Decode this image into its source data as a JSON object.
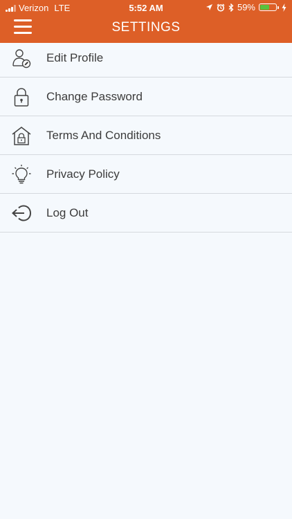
{
  "status_bar": {
    "carrier": "Verizon",
    "network": "LTE",
    "time": "5:52 AM",
    "battery_percent": "59%",
    "battery_level": 0.59,
    "battery_color": "#5ac23d"
  },
  "header": {
    "title": "SETTINGS",
    "background": "#dd5f27"
  },
  "menu": {
    "items": [
      {
        "label": "Edit Profile",
        "icon": "user-edit-icon"
      },
      {
        "label": "Change Password",
        "icon": "lock-icon"
      },
      {
        "label": "Terms And Conditions",
        "icon": "house-lock-icon"
      },
      {
        "label": "Privacy Policy",
        "icon": "lightbulb-icon"
      },
      {
        "label": "Log Out",
        "icon": "logout-icon"
      }
    ]
  }
}
